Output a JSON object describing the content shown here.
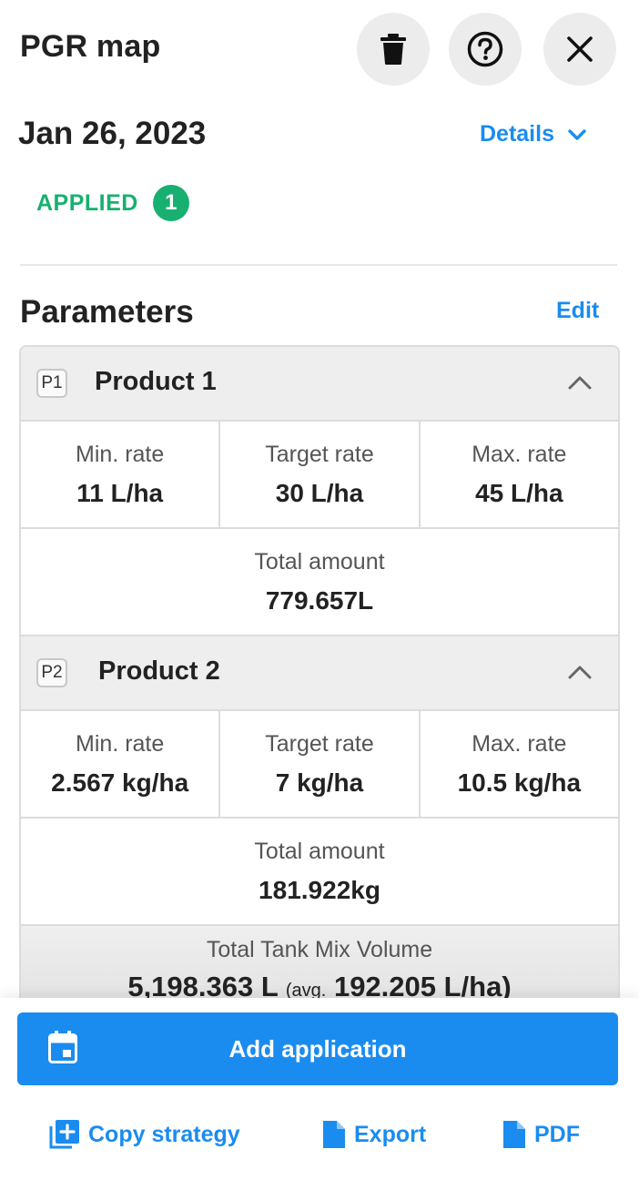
{
  "header": {
    "title": "PGR map",
    "actions": [
      {
        "icon": "trash-icon"
      },
      {
        "icon": "help-circle-icon"
      },
      {
        "icon": "close-icon"
      }
    ]
  },
  "application": {
    "date": "Jan 26, 2023",
    "details_label": "Details",
    "status_label": "APPLIED",
    "status_count": "1"
  },
  "parameters": {
    "title": "Parameters",
    "edit_label": "Edit",
    "products": [
      {
        "badge": "P1",
        "name": "Product 1",
        "min_label": "Min. rate",
        "min_value": "11 L/ha",
        "target_label": "Target rate",
        "target_value": "30 L/ha",
        "max_label": "Max. rate",
        "max_value": "45 L/ha",
        "total_label": "Total amount",
        "total_value": "779.657L"
      },
      {
        "badge": "P2",
        "name": "Product 2",
        "min_label": "Min. rate",
        "min_value": "2.567 kg/ha",
        "target_label": "Target rate",
        "target_value": "7 kg/ha",
        "max_label": "Max. rate",
        "max_value": "10.5 kg/ha",
        "total_label": "Total amount",
        "total_value": "181.922kg"
      }
    ],
    "tank_mix": {
      "label": "Total Tank Mix Volume",
      "value": "5,198.363 L",
      "avg_prefix": "(avg.",
      "avg_value": "192.205 L/ha)"
    }
  },
  "footer": {
    "add_application_label": "Add application",
    "copy_strategy_label": "Copy strategy",
    "export_label": "Export",
    "pdf_label": "PDF"
  },
  "colors": {
    "accent": "#1a8cf0",
    "success": "#17b070",
    "panel_gray": "#eeeeee"
  }
}
